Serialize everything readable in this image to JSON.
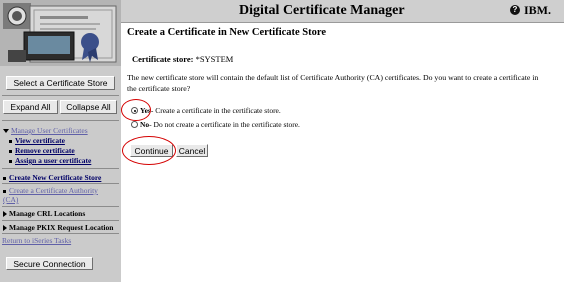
{
  "header": {
    "title": "Digital Certificate Manager",
    "help_glyph": "?",
    "brand": "IBM."
  },
  "sidebar": {
    "select_store_label": "Select a Certificate Store",
    "expand_all_label": "Expand All",
    "collapse_all_label": "Collapse All",
    "manage_user_certs_label": "Manage User Certificates",
    "manage_user_certs_items": [
      "View certificate",
      "Remove certificate",
      "Assign a user certificate"
    ],
    "create_new_store_label": "Create New Certificate Store",
    "create_ca_label": "Create a Certificate Authority (CA)",
    "manage_crl_label": "Manage CRL Locations",
    "manage_pkix_label": "Manage PKIX Request Location",
    "return_label": "Return to iSeries Tasks",
    "secure_connection_label": "Secure Connection"
  },
  "main": {
    "page_title": "Create a Certificate in New Certificate Store",
    "store_label": "Certificate store:",
    "store_value": "*SYSTEM",
    "description": "The new certificate store will contain the default list of Certificate Authority (CA) certificates. Do you want to create a certificate in the certificate store?",
    "options": [
      {
        "key": "Yes",
        "text": " - Create a certificate in the certificate store.",
        "selected": true
      },
      {
        "key": "No",
        "text": " - Do not create a certificate in the certificate store.",
        "selected": false
      }
    ],
    "continue_label": "Continue",
    "cancel_label": "Cancel"
  },
  "annotation_color": "#d40000"
}
